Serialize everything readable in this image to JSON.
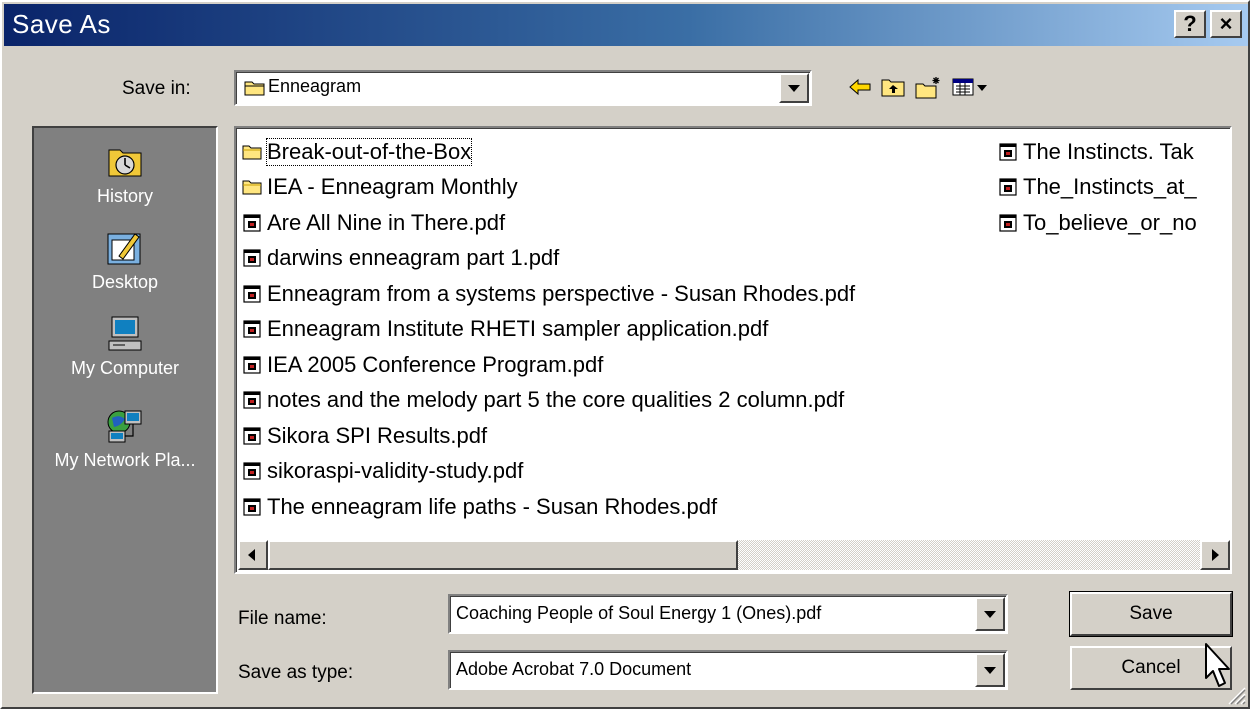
{
  "window": {
    "title": "Save As",
    "help_label": "?",
    "close_label": "×"
  },
  "save_in": {
    "label": "Save in:",
    "value": "Enneagram"
  },
  "places": [
    {
      "label": "History",
      "icon": "history-icon"
    },
    {
      "label": "Desktop",
      "icon": "desktop-icon"
    },
    {
      "label": "My Computer",
      "icon": "computer-icon"
    },
    {
      "label": "My Network Pla...",
      "icon": "network-icon"
    }
  ],
  "files": {
    "col1": [
      {
        "name": "Break-out-of-the-Box",
        "type": "folder"
      },
      {
        "name": "IEA - Enneagram Monthly",
        "type": "folder"
      },
      {
        "name": "Are All Nine in There.pdf",
        "type": "pdf"
      },
      {
        "name": "darwins enneagram part 1.pdf",
        "type": "pdf"
      },
      {
        "name": "Enneagram from a systems perspective - Susan Rhodes.pdf",
        "type": "pdf"
      },
      {
        "name": "Enneagram Institute RHETI sampler application.pdf",
        "type": "pdf"
      },
      {
        "name": "IEA 2005 Conference Program.pdf",
        "type": "pdf"
      },
      {
        "name": "notes and the melody part 5 the core qualities 2 column.pdf",
        "type": "pdf"
      },
      {
        "name": "Sikora SPI Results.pdf",
        "type": "pdf"
      },
      {
        "name": "sikoraspi-validity-study.pdf",
        "type": "pdf"
      },
      {
        "name": "The enneagram life paths - Susan Rhodes.pdf",
        "type": "pdf"
      }
    ],
    "col2": [
      {
        "name": "The Instincts. Tak",
        "type": "pdf"
      },
      {
        "name": "The_Instincts_at_",
        "type": "pdf"
      },
      {
        "name": "To_believe_or_no",
        "type": "pdf"
      }
    ]
  },
  "file_name": {
    "label": "File name:",
    "value": "Coaching People of Soul Energy 1 (Ones).pdf"
  },
  "save_as_type": {
    "label": "Save as type:",
    "value": "Adobe Acrobat 7.0 Document"
  },
  "buttons": {
    "save": "Save",
    "cancel": "Cancel"
  },
  "colors": {
    "title_start": "#0a246a",
    "title_end": "#a6caf0",
    "face": "#d4d0c8",
    "places_bg": "#808080"
  }
}
